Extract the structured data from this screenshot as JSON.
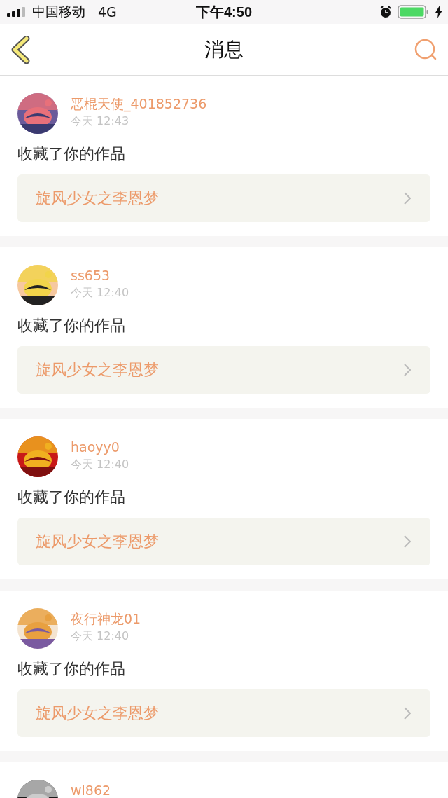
{
  "status_bar": {
    "carrier": "中国移动",
    "network": "4G",
    "time": "下午4:50"
  },
  "header": {
    "title": "消息"
  },
  "messages": [
    {
      "user": "恶棍天使_401852736",
      "time": "今天 12:43",
      "action": "收藏了你的作品",
      "work": "旋风少女之李恩梦"
    },
    {
      "user": "ss653",
      "time": "今天 12:40",
      "action": "收藏了你的作品",
      "work": "旋风少女之李恩梦"
    },
    {
      "user": "haoyy0",
      "time": "今天 12:40",
      "action": "收藏了你的作品",
      "work": "旋风少女之李恩梦"
    },
    {
      "user": "夜行神龙01",
      "time": "今天 12:40",
      "action": "收藏了你的作品",
      "work": "旋风少女之李恩梦"
    },
    {
      "user": "wl862"
    }
  ]
}
